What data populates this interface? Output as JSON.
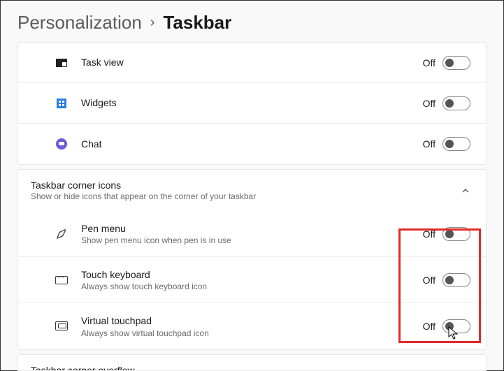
{
  "breadcrumb": {
    "parent": "Personalization",
    "current": "Taskbar"
  },
  "items": [
    {
      "label": "Task view",
      "state": "Off"
    },
    {
      "label": "Widgets",
      "state": "Off"
    },
    {
      "label": "Chat",
      "state": "Off"
    }
  ],
  "corner_section": {
    "title": "Taskbar corner icons",
    "subtitle": "Show or hide icons that appear on the corner of your taskbar"
  },
  "corner_items": [
    {
      "label": "Pen menu",
      "sub": "Show pen menu icon when pen is in use",
      "state": "Off"
    },
    {
      "label": "Touch keyboard",
      "sub": "Always show touch keyboard icon",
      "state": "Off"
    },
    {
      "label": "Virtual touchpad",
      "sub": "Always show virtual touchpad icon",
      "state": "Off"
    }
  ],
  "overflow_section": {
    "title": "Taskbar corner overflow"
  }
}
